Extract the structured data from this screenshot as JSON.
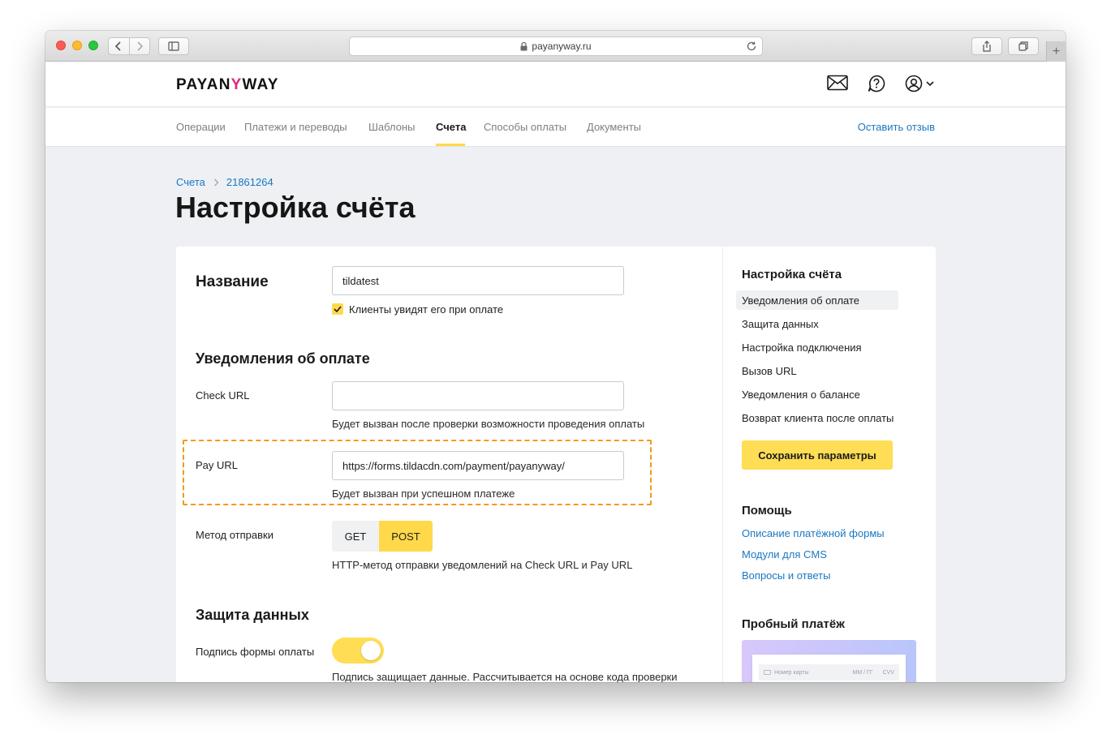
{
  "browser": {
    "url": "payanyway.ru"
  },
  "header": {
    "logo_text_1": "PAYAN",
    "logo_text_y": "Y",
    "logo_text_2": "WAY"
  },
  "nav": {
    "items": [
      {
        "label": "Операции"
      },
      {
        "label": "Платежи и переводы"
      },
      {
        "label": "Шаблоны"
      },
      {
        "label": "Счета"
      },
      {
        "label": "Способы оплаты"
      },
      {
        "label": "Документы"
      }
    ],
    "active": "Счета",
    "feedback": "Оставить отзыв"
  },
  "breadcrumb": {
    "root": "Счета",
    "id": "21861264"
  },
  "page_title": "Настройка счёта",
  "form": {
    "name_title": "Название",
    "name_value": "tildatest",
    "name_checkbox": "Клиенты увидят его при оплате",
    "notify_title": "Уведомления об оплате",
    "check_url_label": "Check URL",
    "check_url_value": "",
    "check_url_hint": "Будет вызван после проверки возможности проведения оплаты",
    "pay_url_label": "Pay URL",
    "pay_url_value": "https://forms.tildacdn.com/payment/payanyway/",
    "pay_url_hint": "Будет вызван при успешном платеже",
    "method_label": "Метод отправки",
    "method_get": "GET",
    "method_post": "POST",
    "method_selected": "POST",
    "method_hint": "HTTP-метод отправки уведомлений на Check URL и Pay URL",
    "security_title": "Защита данных",
    "signature_label": "Подпись формы оплаты",
    "signature_on": true,
    "signature_hint": "Подпись защищает данные. Рассчитывается на основе кода проверки"
  },
  "sidebar": {
    "title": "Настройка счёта",
    "items": [
      {
        "label": "Уведомления об оплате"
      },
      {
        "label": "Защита данных"
      },
      {
        "label": "Настройка подключения"
      },
      {
        "label": "Вызов URL"
      },
      {
        "label": "Уведомления о балансе"
      },
      {
        "label": "Возврат клиента после оплаты"
      }
    ],
    "active": "Уведомления об оплате",
    "save_button": "Сохранить параметры",
    "help_title": "Помощь",
    "help_links": [
      {
        "label": "Описание платёжной формы"
      },
      {
        "label": "Модули для CMS"
      },
      {
        "label": "Вопросы и ответы"
      }
    ],
    "test_title": "Пробный платёж",
    "test_card_placeholder": "Номер карты",
    "test_card_expiry": "ММ / ГГ",
    "test_card_cvv": "CVV"
  },
  "colors": {
    "accent_yellow": "#ffd94a",
    "link_blue": "#1a78c2",
    "highlight_dash": "#f19a1c",
    "logo_pink": "#e5247c"
  }
}
